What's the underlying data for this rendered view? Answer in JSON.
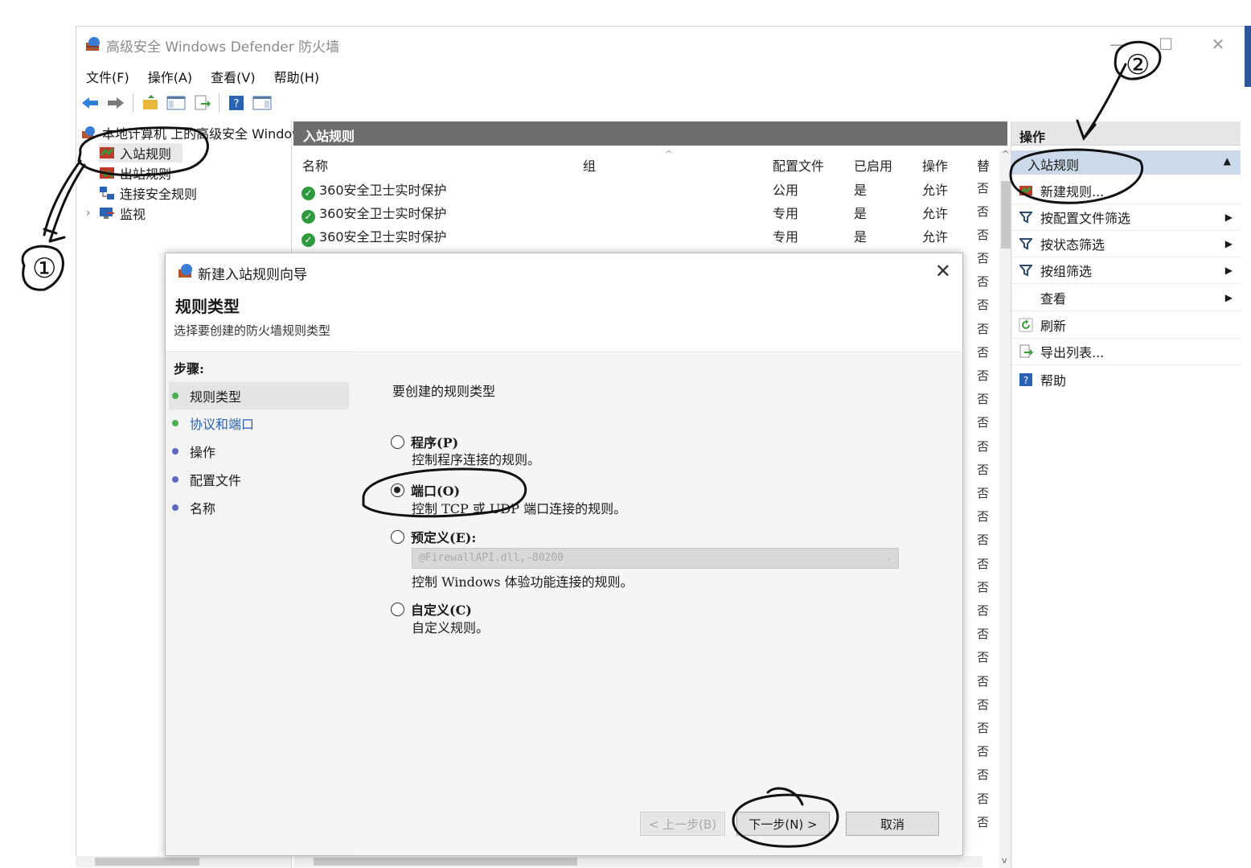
{
  "window": {
    "title": "高级安全 Windows Defender 防火墙",
    "controls": {
      "minimize": "—",
      "maximize": "☐",
      "close": "✕"
    }
  },
  "menu": [
    "文件(F)",
    "操作(A)",
    "查看(V)",
    "帮助(H)"
  ],
  "toolbar": {
    "icons": [
      "back-arrow-icon",
      "forward-arrow-icon",
      "up-folder-icon",
      "show-hide-tree-icon",
      "export-icon",
      "help-icon",
      "action-pane-icon"
    ]
  },
  "tree": {
    "root": "本地计算机 上的高级安全 Windows",
    "items": [
      {
        "label": "入站规则",
        "selected": true
      },
      {
        "label": "出站规则"
      },
      {
        "label": "连接安全规则"
      },
      {
        "label": "监视",
        "expandable": true,
        "chevron": "›"
      }
    ]
  },
  "rules_panel": {
    "header": "入站规则",
    "columns": {
      "name": "名称",
      "group": "组",
      "profile": "配置文件",
      "enabled": "已启用",
      "action": "操作",
      "override": "替"
    },
    "rows": [
      {
        "name": "360安全卫士实时保护",
        "group": "",
        "profile": "公用",
        "enabled": "是",
        "action": "允许",
        "override": "否"
      },
      {
        "name": "360安全卫士实时保护",
        "group": "",
        "profile": "专用",
        "enabled": "是",
        "action": "允许",
        "override": "否"
      },
      {
        "name": "360安全卫士实时保护",
        "group": "",
        "profile": "专用",
        "enabled": "是",
        "action": "允许",
        "override": "否"
      }
    ],
    "overflow_values": [
      "否",
      "否",
      "否",
      "否",
      "否",
      "否",
      "否",
      "否",
      "否",
      "否",
      "否",
      "否",
      "否",
      "否",
      "否",
      "否",
      "否",
      "否",
      "否",
      "否",
      "否",
      "否",
      "否",
      "否",
      "否"
    ]
  },
  "actions_panel": {
    "header": "操作",
    "section": "入站规则",
    "items": [
      {
        "label": "新建规则...",
        "icon": "new-rule-icon",
        "submenu": false
      },
      {
        "label": "按配置文件筛选",
        "icon": "filter-icon",
        "submenu": true
      },
      {
        "label": "按状态筛选",
        "icon": "filter-icon",
        "submenu": true
      },
      {
        "label": "按组筛选",
        "icon": "filter-icon",
        "submenu": true
      },
      {
        "label": "查看",
        "icon": "",
        "submenu": true
      },
      {
        "label": "刷新",
        "icon": "refresh-icon",
        "submenu": false
      },
      {
        "label": "导出列表...",
        "icon": "export-list-icon",
        "submenu": false
      },
      {
        "label": "帮助",
        "icon": "help-icon",
        "submenu": false
      }
    ]
  },
  "wizard": {
    "title": "新建入站规则向导",
    "heading": "规则类型",
    "subheading": "选择要创建的防火墙规则类型",
    "steps_title": "步骤:",
    "steps": [
      {
        "label": "规则类型",
        "color": "#4caf50",
        "active": true
      },
      {
        "label": "协议和端口",
        "color": "#4caf50",
        "link": true
      },
      {
        "label": "操作",
        "color": "#5c6bc0"
      },
      {
        "label": "配置文件",
        "color": "#5c6bc0"
      },
      {
        "label": "名称",
        "color": "#5c6bc0"
      }
    ],
    "question": "要创建的规则类型",
    "options": [
      {
        "label": "程序(P)",
        "desc": "控制程序连接的规则。",
        "selected": false
      },
      {
        "label": "端口(O)",
        "desc": "控制 TCP 或 UDP 端口连接的规则。",
        "selected": true
      },
      {
        "label": "预定义(E):",
        "desc": "控制 Windows 体验功能连接的规则。",
        "selected": false,
        "combo_value": "@FirewallAPI.dll,-80200"
      },
      {
        "label": "自定义(C)",
        "desc": "自定义规则。",
        "selected": false
      }
    ],
    "buttons": {
      "back": "< 上一步(B)",
      "next": "下一步(N) >",
      "cancel": "取消"
    }
  },
  "annotations": {
    "marker_1": "①",
    "marker_2": "②"
  },
  "colors": {
    "accent": "#2b579a",
    "header_dark": "#6e6e6e",
    "selection": "#ccd9ea",
    "check_green": "#2e9a3e"
  }
}
